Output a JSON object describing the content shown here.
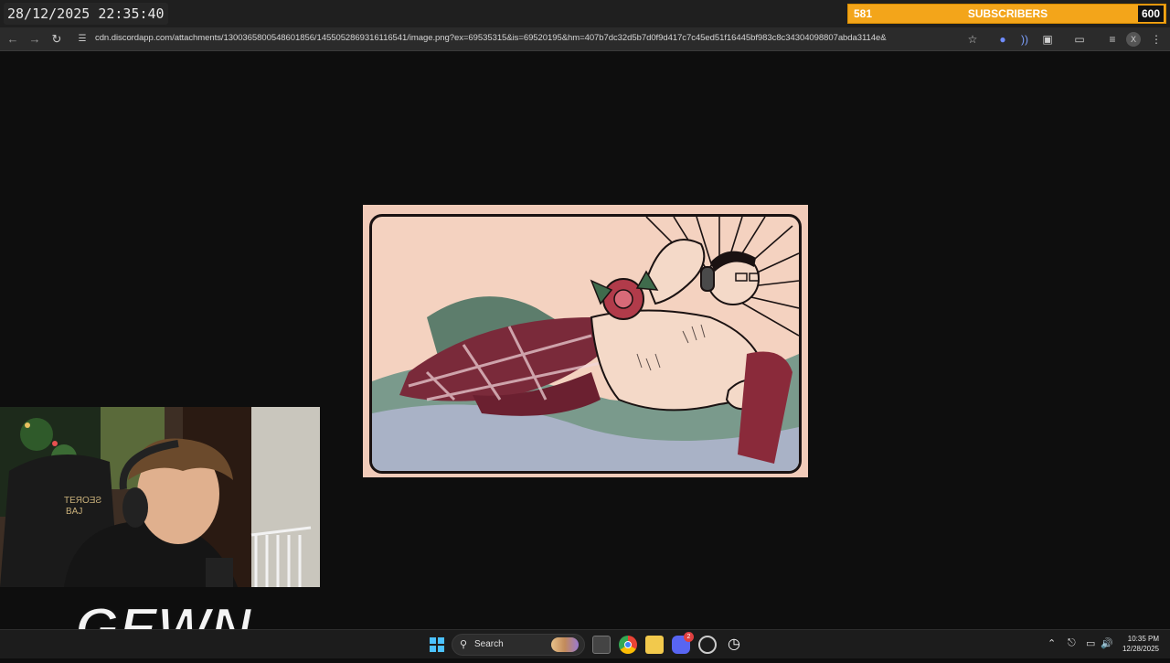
{
  "overlay": {
    "clock": "28/12/2025 22:35:40",
    "subscribers": {
      "current": "581",
      "label": "SUBSCRIBERS",
      "goal": "600",
      "progress": 0.9
    }
  },
  "browser": {
    "url": "cdn.discordapp.com/attachments/1300365800548601856/1455052869316116541/image.png?ex=69535315&is=69520195&hm=407b7dc32d5b7d0f9d417c7c45ed51f16445bf983c8c34304098807abda3114e&",
    "profile_initial": "X"
  },
  "streamer": {
    "logo_text": "GEWN",
    "chair_brand_1": "TEЯOƎƧ",
    "chair_brand_2": "BAJ"
  },
  "taskbar": {
    "search_label": "Search",
    "time": "10:35 PM",
    "date": "12/28/2025",
    "discord_badge": "2"
  },
  "icons": [
    "back-icon",
    "forward-icon",
    "reload-icon",
    "site-info-icon",
    "star-icon",
    "extension-icon",
    "media-icon",
    "side-panel-icon",
    "menu-icon",
    "windows-start-icon",
    "search-icon",
    "chrome-icon",
    "file-explorer-icon",
    "discord-icon",
    "clock-icon"
  ],
  "colors": {
    "subbar": "#f3a51a",
    "page_bg": "#0e0e0e",
    "taskbar": "#1c1c1c"
  }
}
